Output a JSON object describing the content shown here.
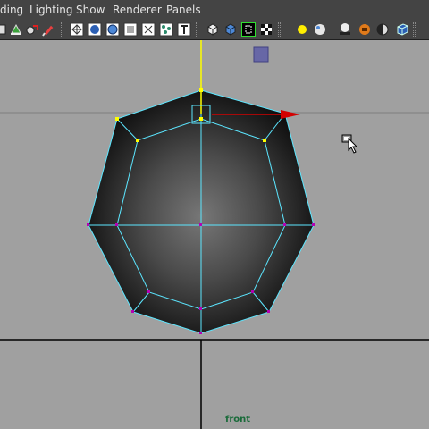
{
  "menu": {
    "items": [
      {
        "id": "shading",
        "label": "ding"
      },
      {
        "id": "lighting",
        "label": "Lighting"
      },
      {
        "id": "show",
        "label": "Show"
      },
      {
        "id": "renderer",
        "label": "Renderer"
      },
      {
        "id": "panels",
        "label": "Panels"
      }
    ]
  },
  "toolbar": {
    "icons": [
      "camera-attributes-icon",
      "bookmark-icon",
      "image-plane-icon",
      "pencil-icon",
      "wireframe-icon",
      "smooth-shade-icon",
      "shaded-wireframe-icon",
      "textured-icon",
      "bounding-box-icon",
      "points-icon",
      "text-icon",
      "isolate-object-icon",
      "isolate-select-icon",
      "xray-icon",
      "checker-icon",
      "default-light-icon",
      "all-lights-icon",
      "shadows-icon",
      "render-icon",
      "halftone-icon",
      "cube-icon"
    ]
  },
  "viewport": {
    "camera_label": "front",
    "label_color": "#1a6b3a",
    "mesh": {
      "wire_color": "#5ce6ff",
      "selected_vertex_color": "#ffff00",
      "vertex_color": "#b400b4"
    },
    "manipulator": {
      "x_axis_color": "#d40000",
      "y_axis_color": "#ffff00",
      "handle_color": "#5ce6ff"
    }
  }
}
